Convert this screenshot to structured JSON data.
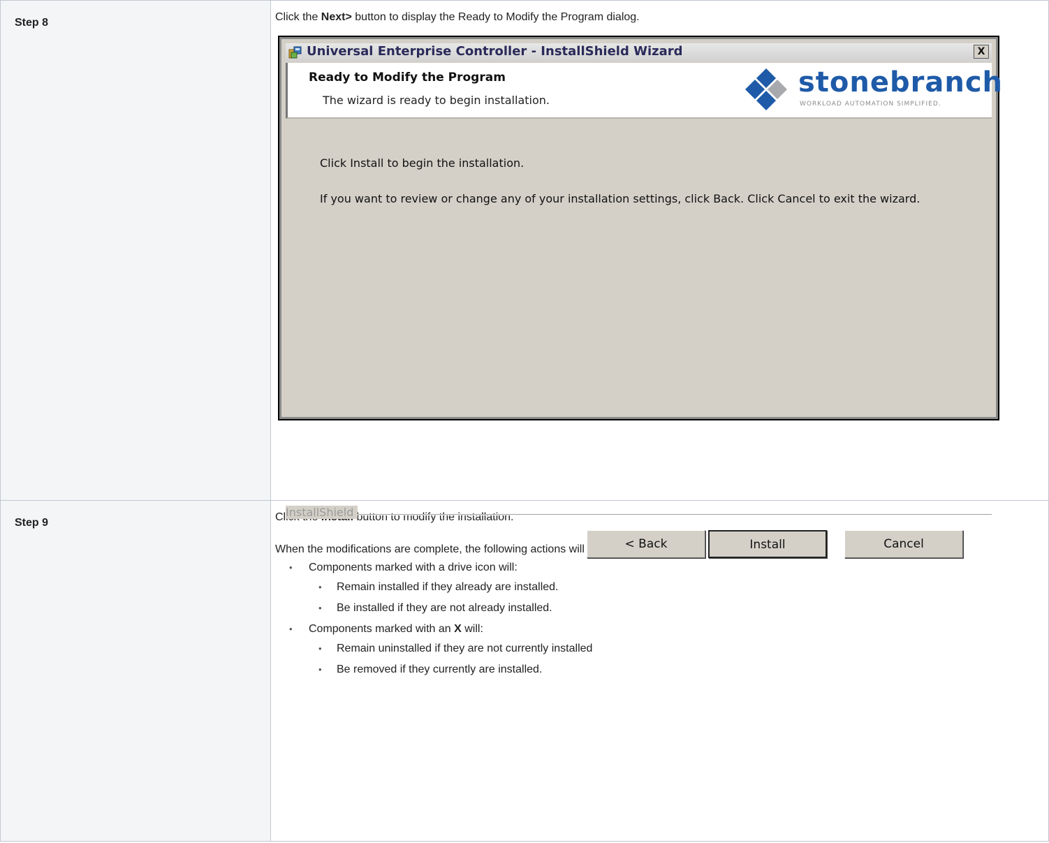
{
  "steps": [
    {
      "label": "Step 8",
      "intro_pre": "Click the ",
      "intro_bold": "Next>",
      "intro_post": " button to display the Ready to Modify the Program dialog."
    },
    {
      "label": "Step 9",
      "intro_pre": "Click the ",
      "intro_bold": "Install",
      "intro_post": " button to modify the installation.",
      "para": "When the modifications are complete, the following actions will be taken:",
      "bullet1": "Components marked with a drive icon will:",
      "bullet1_sub": [
        "Remain installed if they already are installed.",
        "Be installed if they are not already installed."
      ],
      "bullet2_pre": "Components marked with an ",
      "bullet2_bold": "X",
      "bullet2_post": " will:",
      "bullet2_sub": [
        "Remain uninstalled if they are not currently installed",
        "Be removed if they currently are installed."
      ]
    }
  ],
  "wizard": {
    "title": "Universal Enterprise Controller - InstallShield Wizard",
    "close_label": "X",
    "banner_title": "Ready to Modify the Program",
    "banner_subtitle": "The wizard is ready to begin installation.",
    "logo_name": "stonebranch",
    "logo_tagline": "WORKLOAD AUTOMATION SIMPLIFIED.",
    "body_line1": "Click Install to begin the installation.",
    "body_line2": "If you want to review or change any of your installation settings, click Back. Click Cancel to exit the wizard.",
    "footer_label": "InstallShield",
    "back_label": "< Back",
    "install_label": "Install",
    "cancel_label": "Cancel"
  },
  "icons": {
    "title_icon": "installer-icon",
    "logo_icon": "diamond-logo-icon"
  },
  "colors": {
    "logo_blue": "#1e5aa8",
    "logo_gray": "#a7a9ac",
    "dialog_bg": "#d4d0c8",
    "step_cell_bg": "#f4f5f7"
  }
}
